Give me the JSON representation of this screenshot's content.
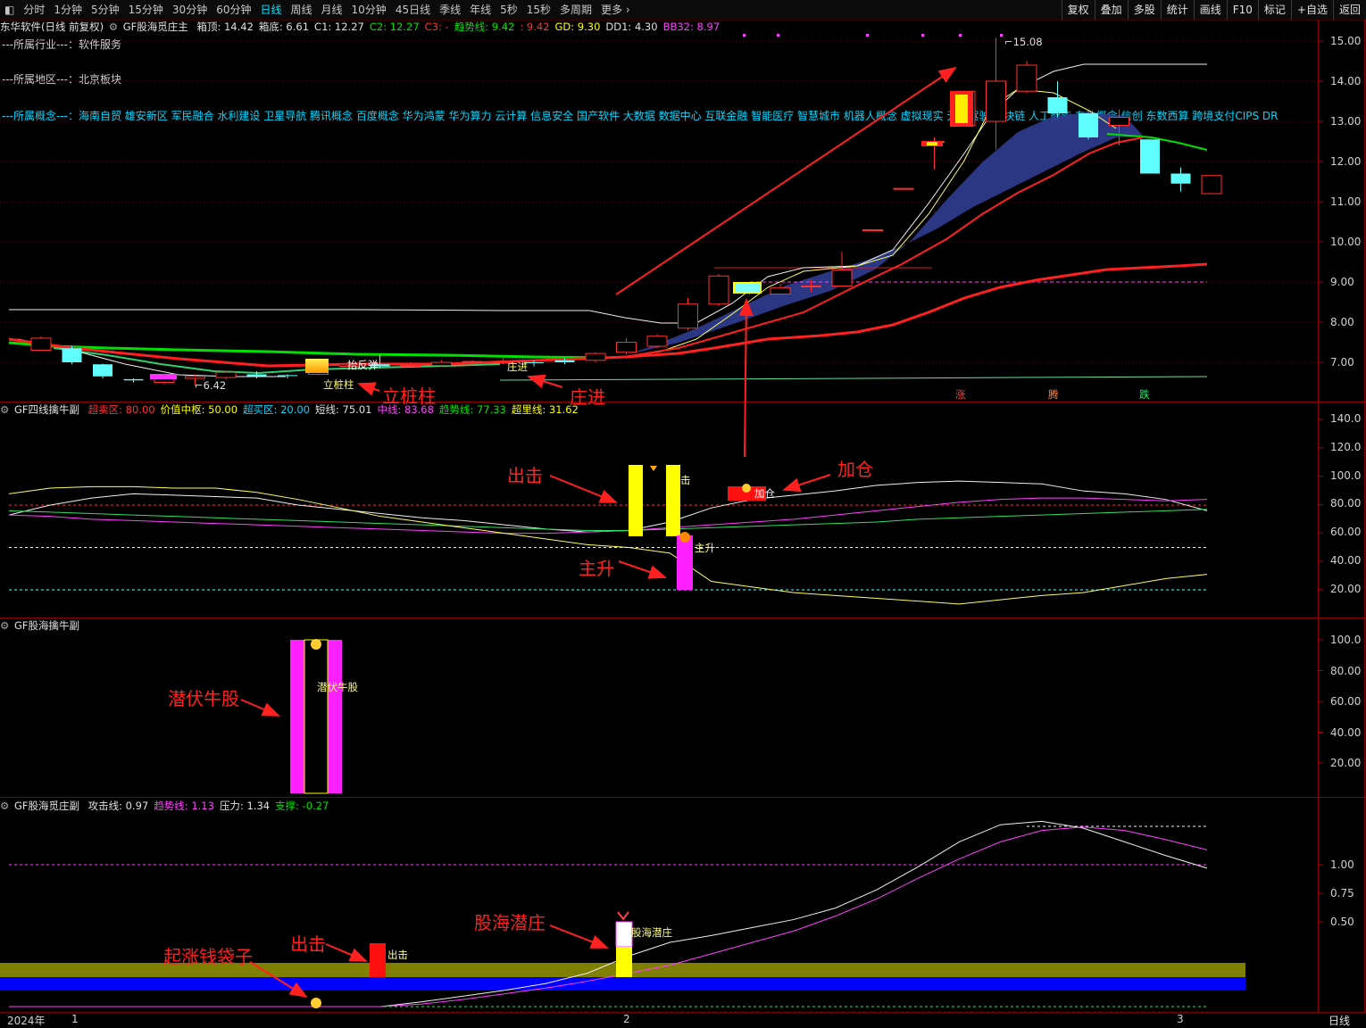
{
  "toolbar": {
    "periods": [
      "分时",
      "1分钟",
      "5分钟",
      "15分钟",
      "30分钟",
      "60分钟",
      "日线",
      "周线",
      "月线",
      "10分钟",
      "45日线",
      "季线",
      "年线",
      "5秒",
      "15秒",
      "多周期",
      "更多"
    ],
    "active": "日线",
    "buttons": [
      "复权",
      "叠加",
      "多股",
      "统计",
      "画线",
      "F10",
      "标记",
      "+自选",
      "返回"
    ]
  },
  "main_panel": {
    "title": "东华软件(日线 前复权)",
    "indicator": "GF股海觅庄主",
    "fields": [
      {
        "label": "箱顶:",
        "value": "14.42",
        "color": "#e0e0e0"
      },
      {
        "label": "箱底:",
        "value": "6.61",
        "color": "#e0e0e0"
      },
      {
        "label": "C1:",
        "value": "12.27",
        "color": "#e0e0e0"
      },
      {
        "label": "C2:",
        "value": "12.27",
        "color": "#00e000"
      },
      {
        "label": "C3:",
        "value": "-",
        "color": "#ff3030"
      },
      {
        "label": "趋势线:",
        "value": "9.42",
        "color": "#00e000"
      },
      {
        "label": ":",
        "value": "9.42",
        "color": "#ff3030"
      },
      {
        "label": "GD:",
        "value": "9.30",
        "color": "#ffff00"
      },
      {
        "label": "DD1:",
        "value": "4.30",
        "color": "#e0e0e0"
      },
      {
        "label": "BB32:",
        "value": "8.97",
        "color": "#ff40ff"
      }
    ],
    "industry_line": "---所属行业---：软件服务",
    "region_line": "---所属地区---：北京板块",
    "concepts_line": "---所属概念---：海南自贸 雄安新区 军民融合 水利建设 卫星导航 腾讯概念 百度概念 华为鸿蒙 华为算力 云计算 信息安全 国产软件 大数据 数据中心 互联金融 智能医疗 智慧城市 机器人概念 虚拟现实 无人驾驶 区块链 人工智能 东数概念 信创 东数西算 跨境支付CIPS DR",
    "y_ticks": [
      "15.00",
      "14.00",
      "13.00",
      "12.00",
      "11.00",
      "10.00",
      "9.00",
      "8.00",
      "7.00"
    ],
    "max_label": "15.08",
    "min_label": "6.42",
    "marks": [
      "抬反弹",
      "立桩柱",
      "庄进",
      "涨",
      "腾",
      "跌"
    ]
  },
  "panel2": {
    "indicator": "GF四线擒牛副",
    "fields": [
      {
        "label": "超卖区:",
        "value": "80.00",
        "color": "#ff3030"
      },
      {
        "label": "价值中枢:",
        "value": "50.00",
        "color": "#ffff00"
      },
      {
        "label": "超买区:",
        "value": "20.00",
        "color": "#00d8ff"
      },
      {
        "label": "短线:",
        "value": "75.01",
        "color": "#e0e0e0"
      },
      {
        "label": "中线:",
        "value": "83.68",
        "color": "#ff40ff"
      },
      {
        "label": "趋势线:",
        "value": "77.33",
        "color": "#00e000"
      },
      {
        "label": "超里线:",
        "value": "31.62",
        "color": "#ffff00"
      }
    ],
    "y_ticks": [
      "140.0",
      "120.0",
      "100.0",
      "80.00",
      "60.00",
      "40.00",
      "20.00"
    ],
    "marks": [
      "击",
      "主升",
      "加仓"
    ]
  },
  "panel3": {
    "indicator": "GF股海擒牛副",
    "y_ticks": [
      "100.0",
      "80.00",
      "60.00",
      "40.00",
      "20.00"
    ],
    "marks": [
      "潜伏牛股"
    ]
  },
  "panel4": {
    "indicator": "GF股海觅庄副",
    "fields": [
      {
        "label": "攻击线:",
        "value": "0.97",
        "color": "#e0e0e0"
      },
      {
        "label": "趋势线:",
        "value": "1.13",
        "color": "#ff40ff"
      },
      {
        "label": "压力:",
        "value": "1.34",
        "color": "#e0e0e0"
      },
      {
        "label": "支撑:",
        "value": "-0.27",
        "color": "#00e000"
      }
    ],
    "y_ticks": [
      "1.00",
      "0.75",
      "0.50"
    ],
    "marks": [
      "出击",
      "股海潜庄"
    ]
  },
  "x_axis": {
    "labels": [
      "2024年",
      "1",
      "2",
      "3"
    ],
    "period": "日线"
  },
  "annotations": [
    "立桩柱",
    "庄进",
    "出击",
    "主升",
    "加仓",
    "潜伏牛股",
    "出击",
    "起涨钱袋子",
    "股海潜庄"
  ],
  "chart_data": [
    {
      "type": "candlestick",
      "title": "东华软件(日线 前复权)",
      "ylim": [
        6.2,
        15.4
      ],
      "candles": [
        {
          "o": 7.3,
          "c": 7.6,
          "h": 7.65,
          "l": 7.28
        },
        {
          "o": 7.35,
          "c": 7.0,
          "h": 7.4,
          "l": 6.95
        },
        {
          "o": 6.95,
          "c": 6.65,
          "h": 6.97,
          "l": 6.6
        },
        {
          "o": 6.58,
          "c": 6.55,
          "h": 6.6,
          "l": 6.5
        },
        {
          "o": 6.5,
          "c": 6.62,
          "h": 6.64,
          "l": 6.45
        },
        {
          "o": 6.6,
          "c": 6.65,
          "h": 6.7,
          "l": 6.42
        },
        {
          "o": 6.62,
          "c": 6.75,
          "h": 6.78,
          "l": 6.58
        },
        {
          "o": 6.7,
          "c": 6.65,
          "h": 6.78,
          "l": 6.6
        },
        {
          "o": 6.68,
          "c": 6.66,
          "h": 6.7,
          "l": 6.6
        },
        {
          "o": 6.7,
          "c": 6.92,
          "h": 6.95,
          "l": 6.68
        },
        {
          "o": 6.9,
          "c": 6.95,
          "h": 7.0,
          "l": 6.85
        },
        {
          "o": 6.95,
          "c": 6.9,
          "h": 7.2,
          "l": 6.85
        },
        {
          "o": 6.9,
          "c": 6.92,
          "h": 7.0,
          "l": 6.88
        },
        {
          "o": 6.92,
          "c": 7.0,
          "h": 7.05,
          "l": 6.9
        },
        {
          "o": 7.0,
          "c": 7.02,
          "h": 7.05,
          "l": 6.96
        },
        {
          "o": 7.0,
          "c": 7.0,
          "h": 7.1,
          "l": 6.95
        },
        {
          "o": 7.0,
          "c": 6.98,
          "h": 7.05,
          "l": 6.9
        },
        {
          "o": 7.05,
          "c": 7.0,
          "h": 7.1,
          "l": 6.95
        },
        {
          "o": 7.05,
          "c": 7.22,
          "h": 7.25,
          "l": 7.0
        },
        {
          "o": 7.25,
          "c": 7.5,
          "h": 7.6,
          "l": 7.2
        },
        {
          "o": 7.4,
          "c": 7.65,
          "h": 7.7,
          "l": 7.35
        },
        {
          "o": 7.85,
          "c": 8.45,
          "h": 8.6,
          "l": 7.8
        },
        {
          "o": 8.45,
          "c": 9.15,
          "h": 9.2,
          "l": 8.4
        },
        {
          "o": 8.9,
          "c": 8.75,
          "h": 9.0,
          "l": 8.7
        },
        {
          "o": 8.7,
          "c": 8.85,
          "h": 8.95,
          "l": 8.7
        },
        {
          "o": 8.9,
          "c": 8.9,
          "h": 9.05,
          "l": 8.75
        },
        {
          "o": 8.9,
          "c": 9.3,
          "h": 9.75,
          "l": 8.9
        },
        {
          "o": 10.3,
          "c": 10.3,
          "h": 10.3,
          "l": 10.3
        },
        {
          "o": 11.33,
          "c": 11.33,
          "h": 11.33,
          "l": 11.33
        },
        {
          "o": 12.5,
          "c": 12.5,
          "h": 12.6,
          "l": 11.8
        },
        {
          "o": 12.9,
          "c": 13.75,
          "h": 13.75,
          "l": 12.9
        },
        {
          "o": 13.0,
          "c": 14.0,
          "h": 15.08,
          "l": 12.3
        },
        {
          "o": 13.75,
          "c": 14.4,
          "h": 14.5,
          "l": 13.7
        },
        {
          "o": 13.6,
          "c": 13.2,
          "h": 14.0,
          "l": 13.1
        },
        {
          "o": 13.2,
          "c": 12.6,
          "h": 13.2,
          "l": 12.55
        },
        {
          "o": 12.9,
          "c": 13.1,
          "h": 13.3,
          "l": 12.4
        },
        {
          "o": 12.55,
          "c": 11.7,
          "h": 12.55,
          "l": 11.7
        },
        {
          "o": 11.7,
          "c": 11.45,
          "h": 11.85,
          "l": 11.25
        },
        {
          "o": 11.2,
          "c": 11.65,
          "h": 11.65,
          "l": 11.2
        }
      ]
    },
    {
      "type": "line",
      "title": "GF四线擒牛副",
      "ylim": [
        0,
        150
      ],
      "levels": [
        80,
        50,
        20
      ],
      "series": [
        {
          "name": "短线",
          "values": [
            73,
            80,
            85,
            88,
            87,
            86,
            85,
            80,
            77,
            74,
            71,
            69,
            66,
            63,
            61,
            62,
            68,
            78,
            84,
            87,
            90,
            94,
            96,
            97,
            96,
            95,
            90,
            88,
            84,
            76
          ]
        },
        {
          "name": "中线",
          "values": [
            73,
            72,
            70,
            69,
            68,
            67,
            66,
            65,
            64,
            63,
            62,
            61,
            60,
            60,
            61,
            62,
            64,
            66,
            68,
            70,
            73,
            76,
            79,
            82,
            84,
            85,
            85,
            84,
            83,
            84
          ]
        },
        {
          "name": "趋势线",
          "values": [
            76,
            75,
            74,
            73,
            72,
            71,
            70,
            69,
            68,
            67,
            66,
            65,
            64,
            63,
            62,
            62,
            63,
            64,
            65,
            66,
            67,
            68,
            70,
            71,
            72,
            73,
            74,
            75,
            76,
            77
          ]
        },
        {
          "name": "超里线",
          "values": [
            88,
            92,
            93,
            93,
            92,
            92,
            89,
            84,
            78,
            72,
            68,
            64,
            60,
            56,
            52,
            50,
            46,
            26,
            22,
            18,
            16,
            14,
            12,
            10,
            13,
            16,
            18,
            23,
            28,
            31
          ]
        }
      ]
    },
    {
      "type": "line",
      "title": "GF股海觅庄副",
      "series": [
        {
          "name": "攻击线",
          "values": [
            -0.35,
            -0.4,
            -0.46,
            -0.5,
            -0.53,
            -0.52,
            -0.45,
            -0.36,
            -0.3,
            -0.25,
            -0.2,
            -0.15,
            -0.1,
            -0.04,
            0.05,
            0.2,
            0.32,
            0.38,
            0.45,
            0.52,
            0.62,
            0.78,
            0.98,
            1.2,
            1.35,
            1.38,
            1.32,
            1.2,
            1.08,
            0.97
          ]
        },
        {
          "name": "趋势线",
          "values": [
            -0.3,
            -0.35,
            -0.4,
            -0.44,
            -0.48,
            -0.5,
            -0.48,
            -0.42,
            -0.35,
            -0.28,
            -0.22,
            -0.18,
            -0.13,
            -0.08,
            -0.02,
            0.05,
            0.12,
            0.22,
            0.32,
            0.42,
            0.55,
            0.7,
            0.88,
            1.05,
            1.2,
            1.3,
            1.33,
            1.3,
            1.22,
            1.13
          ]
        }
      ]
    }
  ]
}
